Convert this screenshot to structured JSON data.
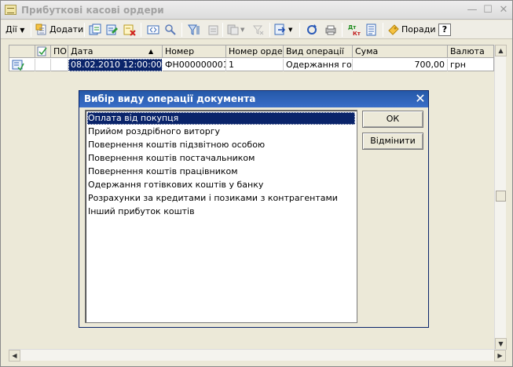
{
  "window": {
    "title": "Прибуткові касові ордери",
    "controls": {
      "minimize": "—",
      "maximize": "☐",
      "close": "✕"
    }
  },
  "toolbar": {
    "actions_label": "Дії",
    "add_label": "Додати",
    "tips_label": "Поради",
    "help_label": "?"
  },
  "grid": {
    "columns": [
      "ПО",
      "Дата",
      "Номер",
      "Номер орде...",
      "Вид операції",
      "Сума",
      "Валюта"
    ],
    "rows": [
      {
        "date": "08.02.2010 12:00:00",
        "number": "ФН000000001",
        "order_number": "1",
        "operation": "Одержання го...",
        "amount": "700,00",
        "currency": "грн"
      }
    ]
  },
  "dialog": {
    "title": "Вибір виду операції документа",
    "close": "✕",
    "items": [
      "Оплата від покупця",
      "Прийом роздрібного виторгу",
      "Повернення коштів підзвітною особою",
      "Повернення коштів постачальником",
      "Повернення коштів працівником",
      "Одержання готівкових коштів у банку",
      "Розрахунки за кредитами і позиками з контрагентами",
      "Інший прибуток коштів"
    ],
    "selected_item": "Оплата від покупця",
    "ok_label": "ОК",
    "cancel_label": "Відмінити"
  },
  "colors": {
    "selection": "#0a246a",
    "dialog_title": "#2f64b8",
    "window_bg": "#ece9d8"
  }
}
